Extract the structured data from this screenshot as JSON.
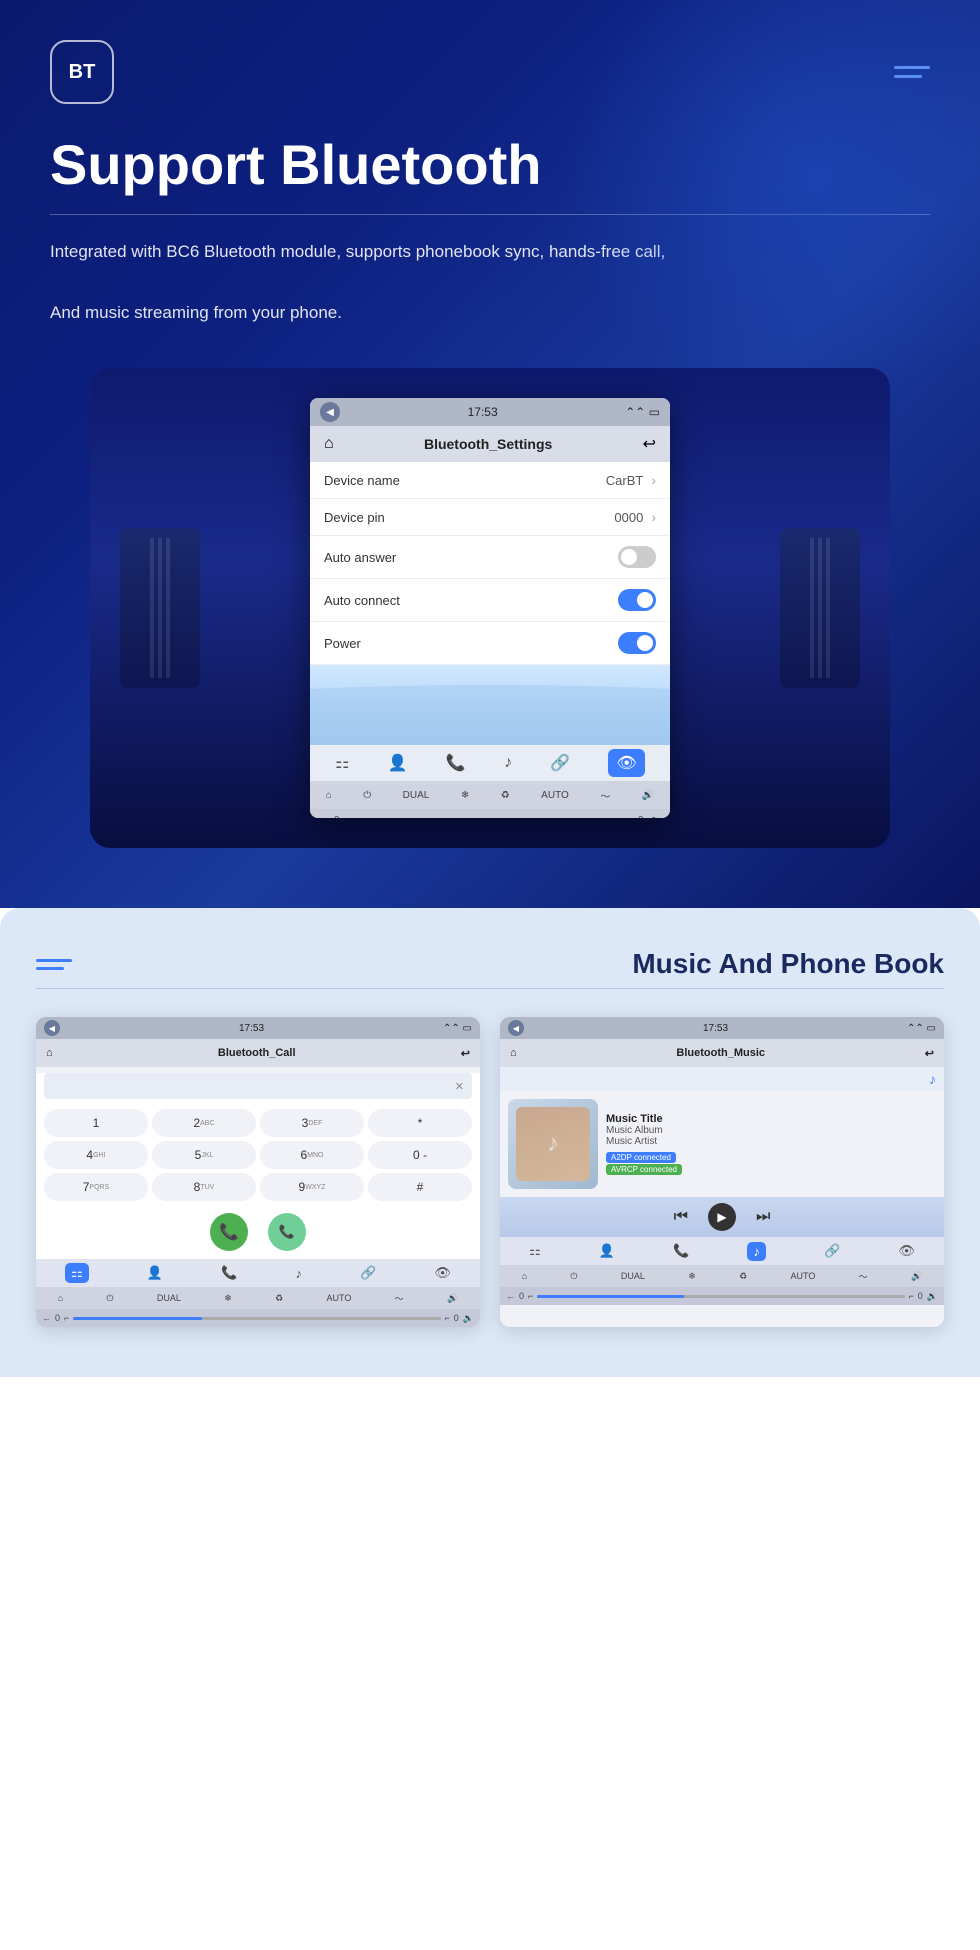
{
  "hero": {
    "logo_text": "BT",
    "title": "Support Bluetooth",
    "description_line1": "Integrated with BC6 Bluetooth module, supports phonebook sync, hands-free call,",
    "description_line2": "And music streaming from your phone.",
    "bt_screen": {
      "statusbar": {
        "time": "17:53"
      },
      "navbar_title": "Bluetooth_Settings",
      "rows": [
        {
          "label": "Device name",
          "value": "CarBT",
          "type": "chevron"
        },
        {
          "label": "Device pin",
          "value": "0000",
          "type": "chevron"
        },
        {
          "label": "Auto answer",
          "value": "",
          "type": "toggle_off"
        },
        {
          "label": "Auto connect",
          "value": "",
          "type": "toggle_on"
        },
        {
          "label": "Power",
          "value": "",
          "type": "toggle_on"
        }
      ],
      "bottom_icons": [
        "≡",
        "👤",
        "📞",
        "♪",
        "🔗",
        "👁"
      ]
    }
  },
  "music_section": {
    "section_title": "Music And Phone Book",
    "phone_screen": {
      "statusbar_time": "17:53",
      "navbar_title": "Bluetooth_Call",
      "dialpad": [
        {
          "key": "1",
          "sub": ""
        },
        {
          "key": "2",
          "sub": "ABC"
        },
        {
          "key": "3",
          "sub": "DEF"
        },
        {
          "key": "*",
          "sub": ""
        },
        {
          "key": "4",
          "sub": "GHI"
        },
        {
          "key": "5",
          "sub": "JKL"
        },
        {
          "key": "6",
          "sub": "MNO"
        },
        {
          "key": "0",
          "sub": "-"
        },
        {
          "key": "7",
          "sub": "PQRS"
        },
        {
          "key": "8",
          "sub": "TUV"
        },
        {
          "key": "9",
          "sub": "WXYZ"
        },
        {
          "key": "#",
          "sub": ""
        }
      ],
      "bottom_icons": [
        "≡",
        "👤",
        "📞",
        "♪",
        "🔗",
        "👁"
      ]
    },
    "music_screen": {
      "statusbar_time": "17:53",
      "navbar_title": "Bluetooth_Music",
      "music_title": "Music Title",
      "music_album": "Music Album",
      "music_artist": "Music Artist",
      "badge1": "A2DP connected",
      "badge2": "AVRCP connected",
      "bottom_icons": [
        "≡",
        "👤",
        "📞",
        "♪",
        "🔗",
        "👁"
      ]
    }
  }
}
